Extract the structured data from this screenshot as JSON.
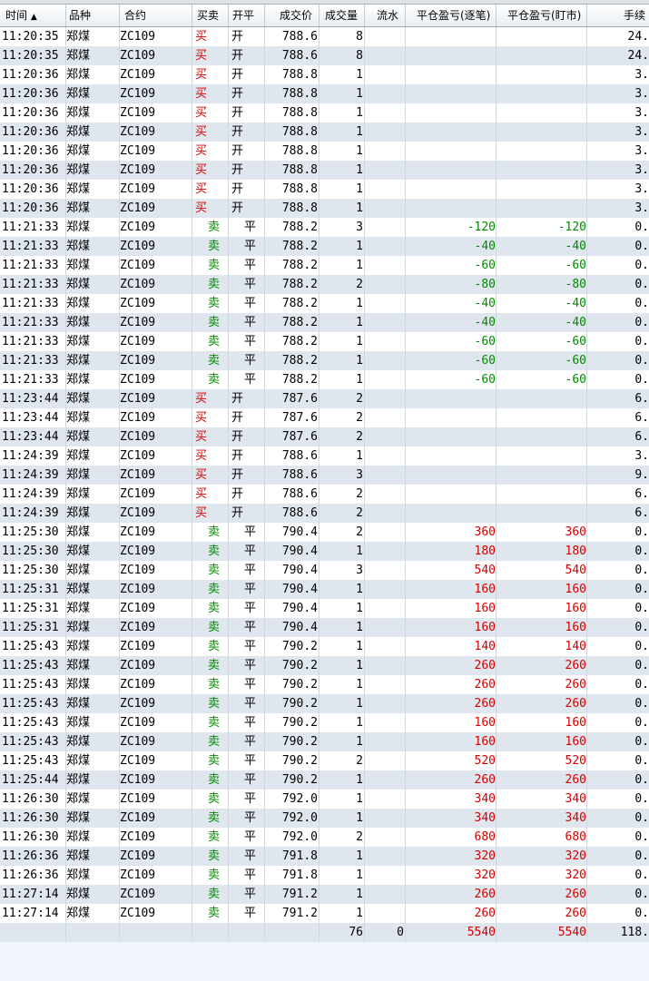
{
  "columns": {
    "time": "时间",
    "sort_arrow": "▲",
    "product": "品种",
    "contract": "合约",
    "side": "买卖",
    "open_close": "开平",
    "price": "成交价",
    "qty": "成交量",
    "flow": "流水",
    "pl_trade": "平仓盈亏(逐笔)",
    "pl_mark": "平仓盈亏(盯市)",
    "fee": "手续"
  },
  "rows": [
    {
      "time": "11:20:35",
      "product": "郑煤",
      "contract": "ZC109",
      "side": "买",
      "oc": "开",
      "price": "788.6",
      "qty": "8",
      "pl1": "",
      "pl2": "",
      "fee": "24."
    },
    {
      "time": "11:20:35",
      "product": "郑煤",
      "contract": "ZC109",
      "side": "买",
      "oc": "开",
      "price": "788.6",
      "qty": "8",
      "pl1": "",
      "pl2": "",
      "fee": "24."
    },
    {
      "time": "11:20:36",
      "product": "郑煤",
      "contract": "ZC109",
      "side": "买",
      "oc": "开",
      "price": "788.8",
      "qty": "1",
      "pl1": "",
      "pl2": "",
      "fee": "3."
    },
    {
      "time": "11:20:36",
      "product": "郑煤",
      "contract": "ZC109",
      "side": "买",
      "oc": "开",
      "price": "788.8",
      "qty": "1",
      "pl1": "",
      "pl2": "",
      "fee": "3."
    },
    {
      "time": "11:20:36",
      "product": "郑煤",
      "contract": "ZC109",
      "side": "买",
      "oc": "开",
      "price": "788.8",
      "qty": "1",
      "pl1": "",
      "pl2": "",
      "fee": "3."
    },
    {
      "time": "11:20:36",
      "product": "郑煤",
      "contract": "ZC109",
      "side": "买",
      "oc": "开",
      "price": "788.8",
      "qty": "1",
      "pl1": "",
      "pl2": "",
      "fee": "3."
    },
    {
      "time": "11:20:36",
      "product": "郑煤",
      "contract": "ZC109",
      "side": "买",
      "oc": "开",
      "price": "788.8",
      "qty": "1",
      "pl1": "",
      "pl2": "",
      "fee": "3."
    },
    {
      "time": "11:20:36",
      "product": "郑煤",
      "contract": "ZC109",
      "side": "买",
      "oc": "开",
      "price": "788.8",
      "qty": "1",
      "pl1": "",
      "pl2": "",
      "fee": "3."
    },
    {
      "time": "11:20:36",
      "product": "郑煤",
      "contract": "ZC109",
      "side": "买",
      "oc": "开",
      "price": "788.8",
      "qty": "1",
      "pl1": "",
      "pl2": "",
      "fee": "3."
    },
    {
      "time": "11:20:36",
      "product": "郑煤",
      "contract": "ZC109",
      "side": "买",
      "oc": "开",
      "price": "788.8",
      "qty": "1",
      "pl1": "",
      "pl2": "",
      "fee": "3."
    },
    {
      "time": "11:21:33",
      "product": "郑煤",
      "contract": "ZC109",
      "side": "卖",
      "oc": "平",
      "price": "788.2",
      "qty": "3",
      "pl1": "-120",
      "pl2": "-120",
      "fee": "0."
    },
    {
      "time": "11:21:33",
      "product": "郑煤",
      "contract": "ZC109",
      "side": "卖",
      "oc": "平",
      "price": "788.2",
      "qty": "1",
      "pl1": "-40",
      "pl2": "-40",
      "fee": "0."
    },
    {
      "time": "11:21:33",
      "product": "郑煤",
      "contract": "ZC109",
      "side": "卖",
      "oc": "平",
      "price": "788.2",
      "qty": "1",
      "pl1": "-60",
      "pl2": "-60",
      "fee": "0."
    },
    {
      "time": "11:21:33",
      "product": "郑煤",
      "contract": "ZC109",
      "side": "卖",
      "oc": "平",
      "price": "788.2",
      "qty": "2",
      "pl1": "-80",
      "pl2": "-80",
      "fee": "0."
    },
    {
      "time": "11:21:33",
      "product": "郑煤",
      "contract": "ZC109",
      "side": "卖",
      "oc": "平",
      "price": "788.2",
      "qty": "1",
      "pl1": "-40",
      "pl2": "-40",
      "fee": "0."
    },
    {
      "time": "11:21:33",
      "product": "郑煤",
      "contract": "ZC109",
      "side": "卖",
      "oc": "平",
      "price": "788.2",
      "qty": "1",
      "pl1": "-40",
      "pl2": "-40",
      "fee": "0."
    },
    {
      "time": "11:21:33",
      "product": "郑煤",
      "contract": "ZC109",
      "side": "卖",
      "oc": "平",
      "price": "788.2",
      "qty": "1",
      "pl1": "-60",
      "pl2": "-60",
      "fee": "0."
    },
    {
      "time": "11:21:33",
      "product": "郑煤",
      "contract": "ZC109",
      "side": "卖",
      "oc": "平",
      "price": "788.2",
      "qty": "1",
      "pl1": "-60",
      "pl2": "-60",
      "fee": "0."
    },
    {
      "time": "11:21:33",
      "product": "郑煤",
      "contract": "ZC109",
      "side": "卖",
      "oc": "平",
      "price": "788.2",
      "qty": "1",
      "pl1": "-60",
      "pl2": "-60",
      "fee": "0."
    },
    {
      "time": "11:23:44",
      "product": "郑煤",
      "contract": "ZC109",
      "side": "买",
      "oc": "开",
      "price": "787.6",
      "qty": "2",
      "pl1": "",
      "pl2": "",
      "fee": "6."
    },
    {
      "time": "11:23:44",
      "product": "郑煤",
      "contract": "ZC109",
      "side": "买",
      "oc": "开",
      "price": "787.6",
      "qty": "2",
      "pl1": "",
      "pl2": "",
      "fee": "6."
    },
    {
      "time": "11:23:44",
      "product": "郑煤",
      "contract": "ZC109",
      "side": "买",
      "oc": "开",
      "price": "787.6",
      "qty": "2",
      "pl1": "",
      "pl2": "",
      "fee": "6."
    },
    {
      "time": "11:24:39",
      "product": "郑煤",
      "contract": "ZC109",
      "side": "买",
      "oc": "开",
      "price": "788.6",
      "qty": "1",
      "pl1": "",
      "pl2": "",
      "fee": "3."
    },
    {
      "time": "11:24:39",
      "product": "郑煤",
      "contract": "ZC109",
      "side": "买",
      "oc": "开",
      "price": "788.6",
      "qty": "3",
      "pl1": "",
      "pl2": "",
      "fee": "9."
    },
    {
      "time": "11:24:39",
      "product": "郑煤",
      "contract": "ZC109",
      "side": "买",
      "oc": "开",
      "price": "788.6",
      "qty": "2",
      "pl1": "",
      "pl2": "",
      "fee": "6."
    },
    {
      "time": "11:24:39",
      "product": "郑煤",
      "contract": "ZC109",
      "side": "买",
      "oc": "开",
      "price": "788.6",
      "qty": "2",
      "pl1": "",
      "pl2": "",
      "fee": "6."
    },
    {
      "time": "11:25:30",
      "product": "郑煤",
      "contract": "ZC109",
      "side": "卖",
      "oc": "平",
      "price": "790.4",
      "qty": "2",
      "pl1": "360",
      "pl2": "360",
      "fee": "0."
    },
    {
      "time": "11:25:30",
      "product": "郑煤",
      "contract": "ZC109",
      "side": "卖",
      "oc": "平",
      "price": "790.4",
      "qty": "1",
      "pl1": "180",
      "pl2": "180",
      "fee": "0."
    },
    {
      "time": "11:25:30",
      "product": "郑煤",
      "contract": "ZC109",
      "side": "卖",
      "oc": "平",
      "price": "790.4",
      "qty": "3",
      "pl1": "540",
      "pl2": "540",
      "fee": "0."
    },
    {
      "time": "11:25:31",
      "product": "郑煤",
      "contract": "ZC109",
      "side": "卖",
      "oc": "平",
      "price": "790.4",
      "qty": "1",
      "pl1": "160",
      "pl2": "160",
      "fee": "0."
    },
    {
      "time": "11:25:31",
      "product": "郑煤",
      "contract": "ZC109",
      "side": "卖",
      "oc": "平",
      "price": "790.4",
      "qty": "1",
      "pl1": "160",
      "pl2": "160",
      "fee": "0."
    },
    {
      "time": "11:25:31",
      "product": "郑煤",
      "contract": "ZC109",
      "side": "卖",
      "oc": "平",
      "price": "790.4",
      "qty": "1",
      "pl1": "160",
      "pl2": "160",
      "fee": "0."
    },
    {
      "time": "11:25:43",
      "product": "郑煤",
      "contract": "ZC109",
      "side": "卖",
      "oc": "平",
      "price": "790.2",
      "qty": "1",
      "pl1": "140",
      "pl2": "140",
      "fee": "0."
    },
    {
      "time": "11:25:43",
      "product": "郑煤",
      "contract": "ZC109",
      "side": "卖",
      "oc": "平",
      "price": "790.2",
      "qty": "1",
      "pl1": "260",
      "pl2": "260",
      "fee": "0."
    },
    {
      "time": "11:25:43",
      "product": "郑煤",
      "contract": "ZC109",
      "side": "卖",
      "oc": "平",
      "price": "790.2",
      "qty": "1",
      "pl1": "260",
      "pl2": "260",
      "fee": "0."
    },
    {
      "time": "11:25:43",
      "product": "郑煤",
      "contract": "ZC109",
      "side": "卖",
      "oc": "平",
      "price": "790.2",
      "qty": "1",
      "pl1": "260",
      "pl2": "260",
      "fee": "0."
    },
    {
      "time": "11:25:43",
      "product": "郑煤",
      "contract": "ZC109",
      "side": "卖",
      "oc": "平",
      "price": "790.2",
      "qty": "1",
      "pl1": "160",
      "pl2": "160",
      "fee": "0."
    },
    {
      "time": "11:25:43",
      "product": "郑煤",
      "contract": "ZC109",
      "side": "卖",
      "oc": "平",
      "price": "790.2",
      "qty": "1",
      "pl1": "160",
      "pl2": "160",
      "fee": "0."
    },
    {
      "time": "11:25:43",
      "product": "郑煤",
      "contract": "ZC109",
      "side": "卖",
      "oc": "平",
      "price": "790.2",
      "qty": "2",
      "pl1": "520",
      "pl2": "520",
      "fee": "0."
    },
    {
      "time": "11:25:44",
      "product": "郑煤",
      "contract": "ZC109",
      "side": "卖",
      "oc": "平",
      "price": "790.2",
      "qty": "1",
      "pl1": "260",
      "pl2": "260",
      "fee": "0."
    },
    {
      "time": "11:26:30",
      "product": "郑煤",
      "contract": "ZC109",
      "side": "卖",
      "oc": "平",
      "price": "792.0",
      "qty": "1",
      "pl1": "340",
      "pl2": "340",
      "fee": "0."
    },
    {
      "time": "11:26:30",
      "product": "郑煤",
      "contract": "ZC109",
      "side": "卖",
      "oc": "平",
      "price": "792.0",
      "qty": "1",
      "pl1": "340",
      "pl2": "340",
      "fee": "0."
    },
    {
      "time": "11:26:30",
      "product": "郑煤",
      "contract": "ZC109",
      "side": "卖",
      "oc": "平",
      "price": "792.0",
      "qty": "2",
      "pl1": "680",
      "pl2": "680",
      "fee": "0."
    },
    {
      "time": "11:26:36",
      "product": "郑煤",
      "contract": "ZC109",
      "side": "卖",
      "oc": "平",
      "price": "791.8",
      "qty": "1",
      "pl1": "320",
      "pl2": "320",
      "fee": "0."
    },
    {
      "time": "11:26:36",
      "product": "郑煤",
      "contract": "ZC109",
      "side": "卖",
      "oc": "平",
      "price": "791.8",
      "qty": "1",
      "pl1": "320",
      "pl2": "320",
      "fee": "0."
    },
    {
      "time": "11:27:14",
      "product": "郑煤",
      "contract": "ZC109",
      "side": "卖",
      "oc": "平",
      "price": "791.2",
      "qty": "1",
      "pl1": "260",
      "pl2": "260",
      "fee": "0."
    },
    {
      "time": "11:27:14",
      "product": "郑煤",
      "contract": "ZC109",
      "side": "卖",
      "oc": "平",
      "price": "791.2",
      "qty": "1",
      "pl1": "260",
      "pl2": "260",
      "fee": "0."
    }
  ],
  "totals": {
    "qty": "76",
    "flow": "0",
    "pl1": "5540",
    "pl2": "5540",
    "fee": "118."
  },
  "colors": {
    "buy": "#d40000",
    "sell": "#008a00",
    "profit": "#d40000",
    "loss": "#008a00"
  }
}
